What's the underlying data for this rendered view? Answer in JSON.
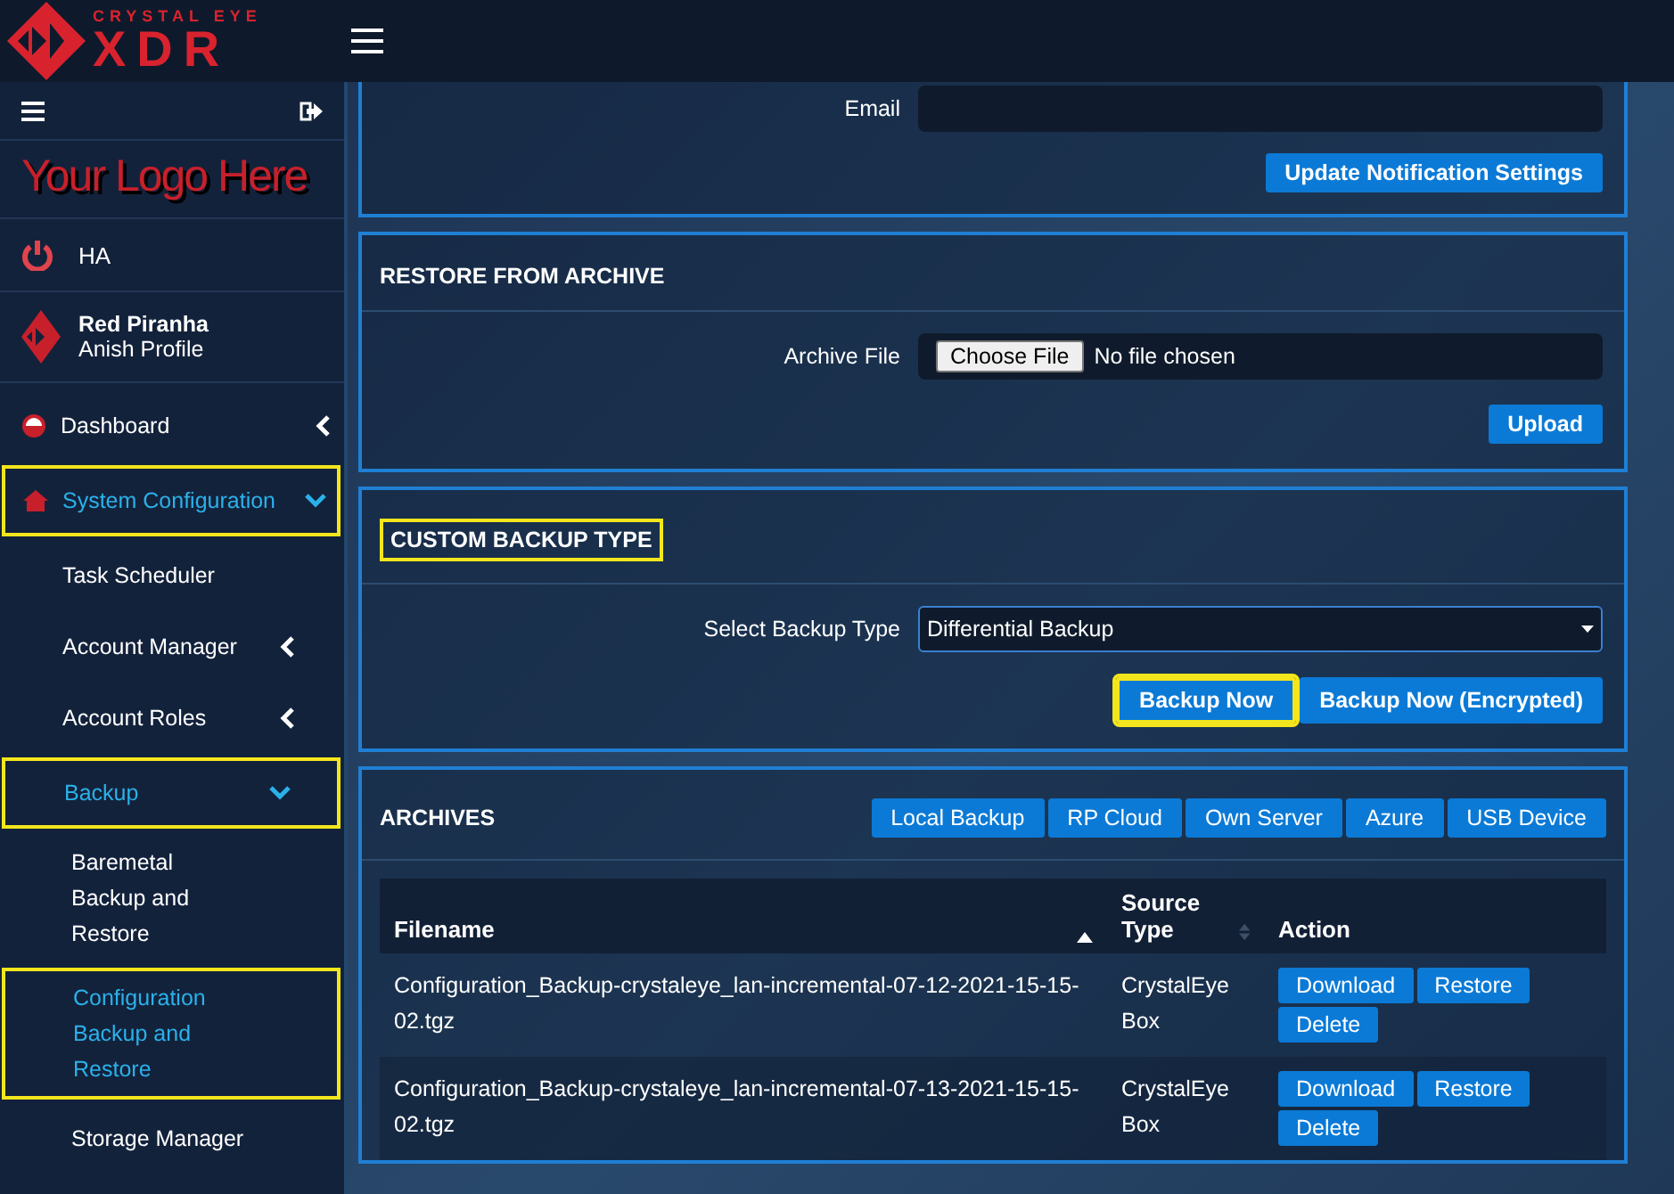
{
  "header": {
    "brand_tagline": "CRYSTAL EYE",
    "brand_name": "XDR"
  },
  "sidebar": {
    "logo_text": "Your Logo Here",
    "ha_label": "HA",
    "profile": {
      "name": "Red Piranha",
      "subtitle": "Anish Profile"
    },
    "items": [
      {
        "label": "Dashboard",
        "expanded": false,
        "selected": false,
        "highlighted": false
      },
      {
        "label": "System Configuration",
        "expanded": true,
        "selected": true,
        "highlighted": true,
        "children": [
          {
            "label": "Task Scheduler",
            "selected": false,
            "highlighted": false
          },
          {
            "label": "Account Manager",
            "expanded": false,
            "selected": false,
            "highlighted": false
          },
          {
            "label": "Account Roles",
            "expanded": false,
            "selected": false,
            "highlighted": false
          },
          {
            "label": "Backup",
            "expanded": true,
            "selected": true,
            "highlighted": true,
            "children": [
              {
                "label": "Baremetal Backup and Restore",
                "selected": false,
                "highlighted": false
              },
              {
                "label": "Configuration Backup and Restore",
                "selected": true,
                "highlighted": true
              },
              {
                "label": "Storage Manager",
                "selected": false,
                "highlighted": false
              }
            ]
          }
        ]
      }
    ]
  },
  "notification": {
    "email_label": "Email",
    "button": "Update Notification Settings"
  },
  "restore": {
    "title": "RESTORE FROM ARCHIVE",
    "field_label": "Archive File",
    "choose_button": "Choose File",
    "file_status": "No file chosen",
    "upload_button": "Upload"
  },
  "custom_backup": {
    "title": "CUSTOM BACKUP TYPE",
    "title_highlighted": true,
    "field_label": "Select Backup Type",
    "selected_value": "Differential Backup",
    "buttons": [
      {
        "label": "Backup Now",
        "highlighted": true
      },
      {
        "label": "Backup Now (Encrypted)",
        "highlighted": false
      }
    ]
  },
  "archives": {
    "title": "ARCHIVES",
    "destinations": [
      "Local Backup",
      "RP Cloud",
      "Own Server",
      "Azure",
      "USB Device"
    ],
    "table": {
      "columns": [
        {
          "label": "Filename",
          "sorted": true
        },
        {
          "label": "Source Type",
          "sorted": false
        },
        {
          "label": "Action"
        }
      ],
      "rows": [
        {
          "filename": "Configuration_Backup-crystaleye_lan-incremental-07-12-2021-15-15-02.tgz",
          "source_type": "CrystalEye Box",
          "actions": [
            "Download",
            "Restore",
            "Delete"
          ]
        },
        {
          "filename": "Configuration_Backup-crystaleye_lan-incremental-07-13-2021-15-15-02.tgz",
          "source_type": "CrystalEye Box",
          "actions": [
            "Download",
            "Restore",
            "Delete"
          ]
        }
      ]
    }
  }
}
